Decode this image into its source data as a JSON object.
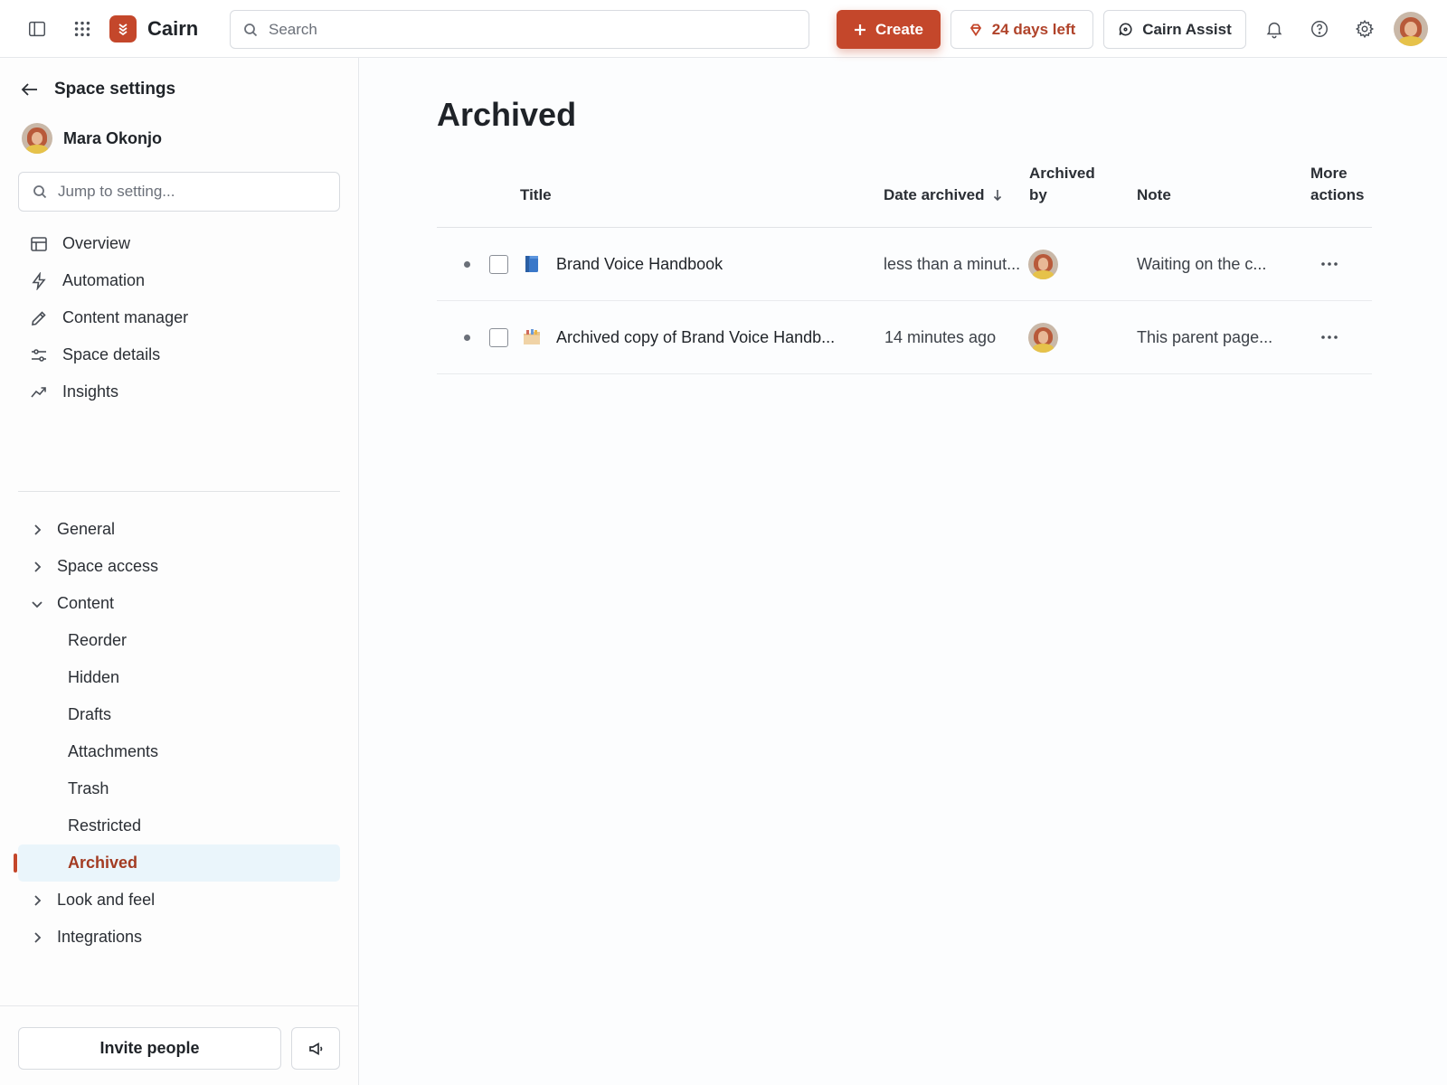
{
  "app": {
    "name": "Cairn"
  },
  "topbar": {
    "search_placeholder": "Search",
    "create_label": "Create",
    "trial_label": "24 days left",
    "assist_label": "Cairn Assist"
  },
  "sidebar": {
    "back_label": "Space settings",
    "space_name": "Mara Okonjo",
    "jump_placeholder": "Jump to setting...",
    "nav": [
      {
        "label": "Overview",
        "icon": "layout-icon"
      },
      {
        "label": "Automation",
        "icon": "lightning-icon"
      },
      {
        "label": "Content manager",
        "icon": "pencil-icon"
      },
      {
        "label": "Space details",
        "icon": "sliders-icon"
      },
      {
        "label": "Insights",
        "icon": "trend-icon"
      }
    ],
    "tree": {
      "general": "General",
      "space_access": "Space access",
      "content": "Content",
      "content_children": [
        "Reorder",
        "Hidden",
        "Drafts",
        "Attachments",
        "Trash",
        "Restricted",
        "Archived"
      ],
      "look_and_feel": "Look and feel",
      "integrations": "Integrations"
    },
    "active_item": "Archived",
    "invite_label": "Invite people"
  },
  "main": {
    "title": "Archived",
    "columns": {
      "title": "Title",
      "date_archived": "Date archived",
      "archived_by_1": "Archived",
      "archived_by_2": "by",
      "note": "Note",
      "more_1": "More",
      "more_2": "actions"
    },
    "rows": [
      {
        "title": "Brand Voice Handbook",
        "icon": "book-icon",
        "date": "less than a minut...",
        "note": "Waiting on the c..."
      },
      {
        "title": "Archived copy of Brand Voice Handb...",
        "icon": "folder-icon",
        "date": "14 minutes ago",
        "note": "This parent page..."
      }
    ]
  },
  "colors": {
    "accent": "#c4472b",
    "active_bg": "#eaf5fb"
  }
}
